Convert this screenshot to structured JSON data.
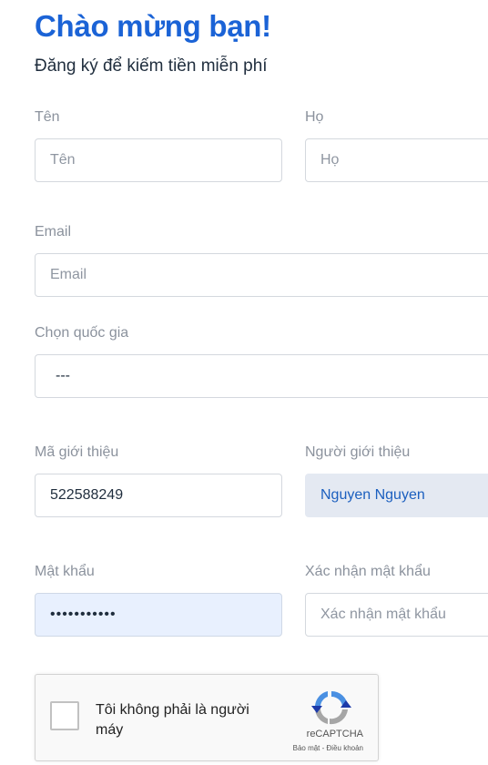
{
  "header": {
    "title": "Chào mừng bạn!",
    "subtitle": "Đăng ký để kiếm tiền miễn phí"
  },
  "form": {
    "first_name": {
      "label": "Tên",
      "placeholder": "Tên",
      "value": ""
    },
    "last_name": {
      "label": "Họ",
      "placeholder": "Họ",
      "value": ""
    },
    "email": {
      "label": "Email",
      "placeholder": "Email",
      "value": ""
    },
    "country": {
      "label": "Chọn quốc gia",
      "selected": "---"
    },
    "referral_code": {
      "label": "Mã giới thiệu",
      "value": "522588249"
    },
    "referrer": {
      "label": "Người giới thiệu",
      "value": "Nguyen Nguyen"
    },
    "password": {
      "label": "Mật khẩu",
      "value": "•••••••••••"
    },
    "confirm_password": {
      "label": "Xác nhận mật khẩu",
      "placeholder": "Xác nhận mật khẩu",
      "value": ""
    }
  },
  "captcha": {
    "label": "Tôi không phải là người máy",
    "brand": "reCAPTCHA",
    "privacy": "Bảo mật",
    "separator": " - ",
    "terms": "Điều khoản",
    "checked": false
  },
  "colors": {
    "accent": "#1b63d6",
    "label": "#8b929d",
    "readonly_bg": "#e4e9f2",
    "autofill_bg": "#e8f0fe"
  }
}
